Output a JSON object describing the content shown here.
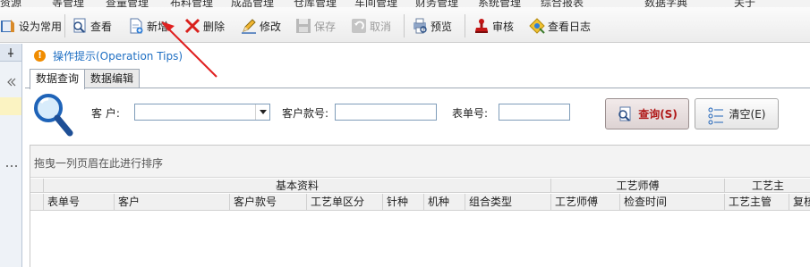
{
  "menubar": {
    "items": [
      "资源",
      "等管理",
      "查量管理",
      "布料管理",
      "成品管理",
      "仓库管理",
      "车间管理",
      "财务管理",
      "系统管理",
      "综合报表",
      "数据字典",
      "关于"
    ]
  },
  "toolbar": {
    "buttons": [
      {
        "label": "设为常用",
        "icon": "book-icon",
        "enabled": true
      },
      {
        "label": "查看",
        "icon": "view-icon",
        "enabled": true
      },
      {
        "label": "新增",
        "icon": "new-doc-icon",
        "enabled": true
      },
      {
        "label": "删除",
        "icon": "delete-x-icon",
        "enabled": true
      },
      {
        "label": "修改",
        "icon": "pencil-icon",
        "enabled": true
      },
      {
        "label": "保存",
        "icon": "floppy-icon",
        "enabled": false
      },
      {
        "label": "取消",
        "icon": "undo-icon",
        "enabled": false
      },
      {
        "label": "预览",
        "icon": "preview-icon",
        "enabled": true
      },
      {
        "label": "审核",
        "icon": "stamp-icon",
        "enabled": true
      },
      {
        "label": "查看日志",
        "icon": "log-icon",
        "enabled": true
      }
    ]
  },
  "main": {
    "tip": "操作提示(Operation Tips)",
    "tabs": [
      {
        "label": "数据查询",
        "active": true
      },
      {
        "label": "数据编辑",
        "active": false
      }
    ],
    "search": {
      "customer_label": "客 户:",
      "customer_value": "",
      "style_no_label": "客户款号:",
      "style_no_value": "",
      "form_no_label": "表单号:",
      "form_no_value": "",
      "query_button": "查询(S)",
      "clear_button": "清空(E)"
    },
    "grid": {
      "group_hint": "拖曳一列页眉在此进行排序",
      "bands": [
        "基本资料",
        "工艺师傅",
        "工艺主"
      ],
      "columns": [
        "表单号",
        "客户",
        "客户款号",
        "工艺单区分",
        "针种",
        "机种",
        "组合类型",
        "工艺师傅",
        "检查时间",
        "工艺主管",
        "复核"
      ]
    }
  },
  "colors": {
    "tip_text": "#1f6fc3",
    "annotation_arrow": "#e02020",
    "query_text": "#b01818"
  }
}
